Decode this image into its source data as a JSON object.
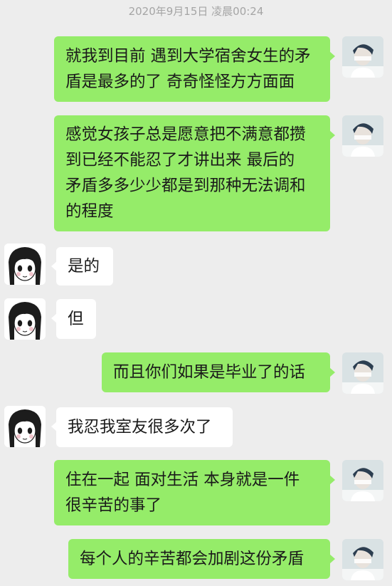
{
  "header": {
    "timestamp": "2020年9月15日 凌晨00:24"
  },
  "messages": [
    {
      "sender": "me",
      "lines": [
        "就我到目前 遇到大学宿舍女生的矛",
        "盾是最多的了  奇奇怪怪方方面面"
      ]
    },
    {
      "sender": "me",
      "lines": [
        "感觉女孩子总是愿意把不满意都攒",
        "到已经不能忍了才讲出来  最后的",
        "矛盾多多少少都是到那种无法调和",
        "的程度"
      ]
    },
    {
      "sender": "other",
      "lines": [
        "是的"
      ]
    },
    {
      "sender": "other",
      "lines": [
        "但"
      ]
    },
    {
      "sender": "me",
      "lines": [
        "而且你们如果是毕业了的话"
      ]
    },
    {
      "sender": "other",
      "lines": [
        "我忍我室友很多次了"
      ]
    },
    {
      "sender": "me",
      "lines": [
        "住在一起 面对生活 本身就是一件",
        "很辛苦的事了"
      ]
    },
    {
      "sender": "me",
      "lines": [
        "每个人的辛苦都会加剧这份矛盾"
      ]
    }
  ],
  "icons": {
    "me_avatar": "boy-avatar-icon",
    "other_avatar": "manga-girl-avatar-icon"
  },
  "colors": {
    "background": "#ededed",
    "my_bubble": "#95ec69",
    "other_bubble": "#ffffff",
    "timestamp_text": "#a5a5a5"
  }
}
